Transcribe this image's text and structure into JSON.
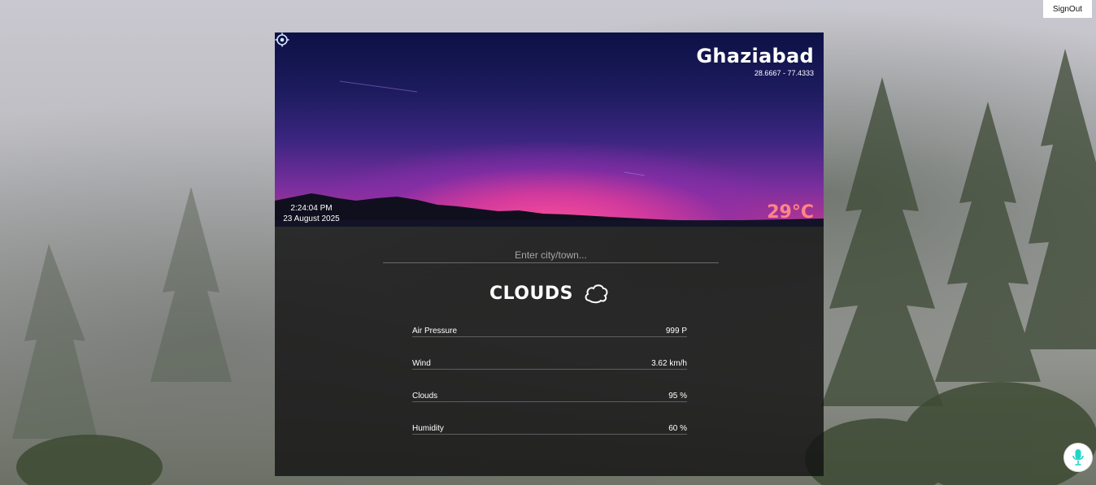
{
  "header": {
    "signout_label": "SignOut"
  },
  "weather": {
    "city": "Ghaziabad",
    "coordinates": "28.6667 - 77.4333",
    "time": "2:24:04 PM",
    "date": "23 August 2025",
    "temperature": "29°C",
    "condition": "CLOUDS"
  },
  "search": {
    "placeholder": "Enter city/town..."
  },
  "stats": [
    {
      "label": "Air Pressure",
      "value": "999 P"
    },
    {
      "label": "Wind",
      "value": "3.62 km/h"
    },
    {
      "label": "Clouds",
      "value": "95 %"
    },
    {
      "label": "Humidity",
      "value": "60 %"
    }
  ],
  "icons": {
    "locate": "crosshair-icon",
    "condition": "cloud-icon",
    "voice": "microphone-icon"
  },
  "colors": {
    "temperature": "#ff8585",
    "mic_accent": "#1ed6c8"
  }
}
